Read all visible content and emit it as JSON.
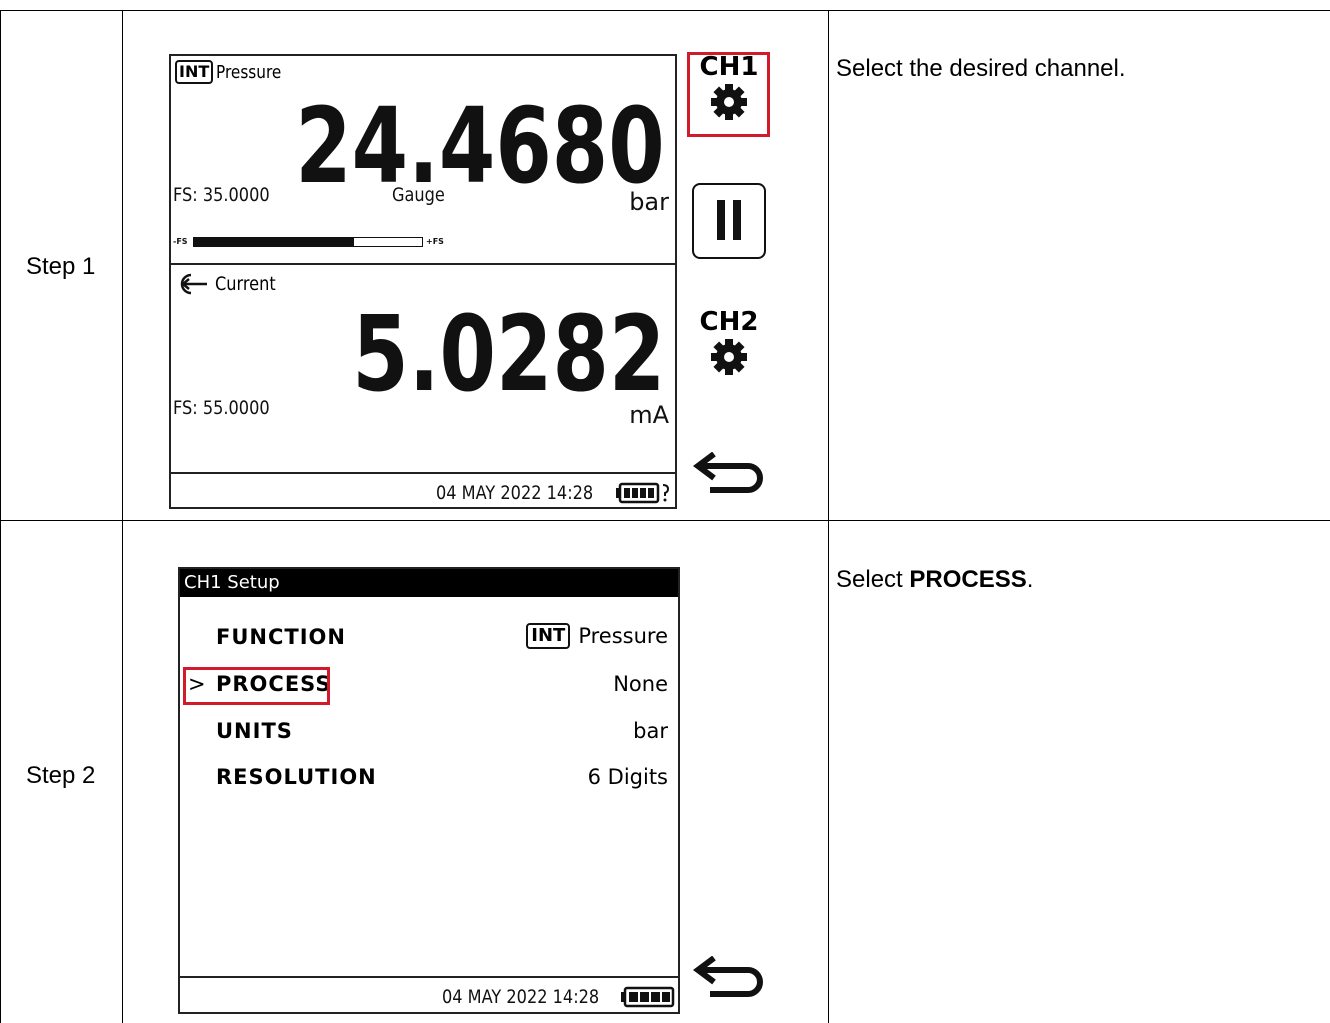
{
  "steps": [
    {
      "label": "Step 1",
      "instruction": "Select the desired channel.",
      "screen": {
        "ch1": {
          "badge": "INT",
          "title": "Pressure",
          "value": "24.4680",
          "fs": "FS: 35.0000",
          "mode": "Gauge",
          "unit": "bar",
          "bar_min": "-FS",
          "bar_max": "+FS",
          "bar_fill_fraction": 0.7
        },
        "ch2": {
          "title": "Current",
          "value": "5.0282",
          "fs": "FS: 55.0000",
          "unit": "mA"
        },
        "status_datetime": "04 MAY 2022 14:28"
      },
      "side_buttons": {
        "ch1_label": "CH1",
        "ch2_label": "CH2"
      }
    },
    {
      "label": "Step 2",
      "instruction_prefix": "Select ",
      "instruction_bold": "PROCESS",
      "instruction_suffix": ".",
      "screen": {
        "title": "CH1 Setup",
        "menu": [
          {
            "label": "FUNCTION",
            "badge": "INT",
            "value": "Pressure",
            "selected": false
          },
          {
            "label": "PROCESS",
            "value": "None",
            "selected": true,
            "marker": ">"
          },
          {
            "label": "UNITS",
            "value": "bar",
            "selected": false
          },
          {
            "label": "RESOLUTION",
            "value": "6 Digits",
            "selected": false
          }
        ],
        "status_datetime": "04 MAY 2022 14:28"
      }
    }
  ],
  "colors": {
    "highlight": "#d11a2a",
    "screen_text": "#111111",
    "grid": "#000000"
  },
  "icons": [
    "gear-icon",
    "pause-icon",
    "back-arrow-icon",
    "current-input-icon",
    "battery-icon"
  ]
}
